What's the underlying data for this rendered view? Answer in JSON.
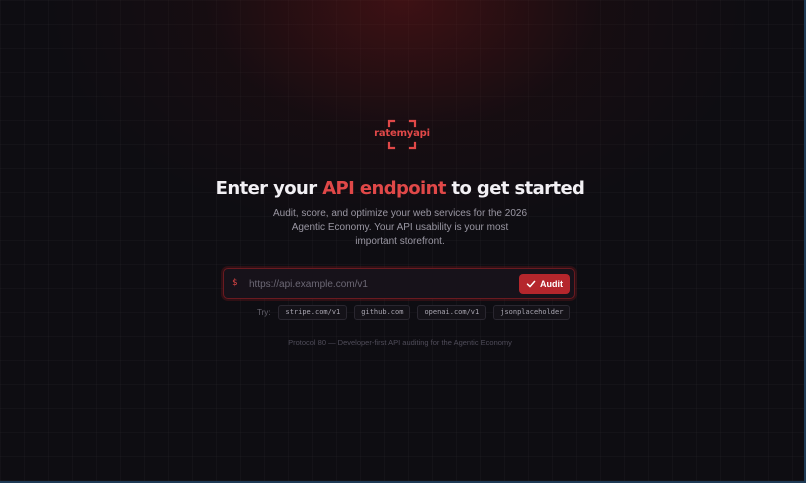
{
  "logo": {
    "text": "ratemyapi",
    "accent_color": "#e04848"
  },
  "headline": {
    "before": "Enter your ",
    "accent": "API endpoint",
    "after": " to get started"
  },
  "subtitle": "Audit, score, and optimize your web services for the 2026 Agentic Economy. Your API usability is your most important storefront.",
  "search": {
    "prefix": "$",
    "placeholder": "https://api.example.com/v1",
    "value": "",
    "button_label": "Audit",
    "button_color": "#b5262c"
  },
  "suggestions": {
    "label": "Try:",
    "items": [
      "stripe.com/v1",
      "github.com",
      "openai.com/v1",
      "jsonplaceholder"
    ]
  },
  "footer": "Protocol 80 — Developer-first API auditing for the Agentic Economy"
}
